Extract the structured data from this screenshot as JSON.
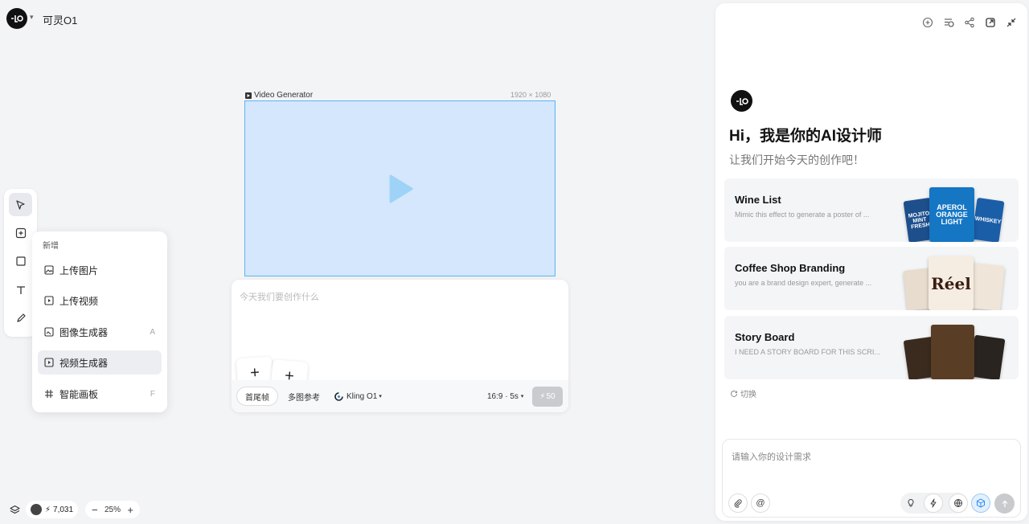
{
  "app": {
    "title": "可灵O1"
  },
  "add_menu": {
    "header": "新增",
    "items": [
      {
        "label": "上传图片",
        "shortcut": ""
      },
      {
        "label": "上传视频",
        "shortcut": ""
      },
      {
        "label": "图像生成器",
        "shortcut": "A"
      },
      {
        "label": "视频生成器",
        "shortcut": ""
      },
      {
        "label": "智能画板",
        "shortcut": "F"
      }
    ]
  },
  "frame": {
    "label": "Video Generator",
    "size": "1920 × 1080"
  },
  "prompt": {
    "placeholder": "今天我们要创作什么",
    "mode_first_last": "首尾帧",
    "mode_multi_ref": "多图参考",
    "model": "Kling O1",
    "settings": "16:9 · 5s",
    "cost": "50"
  },
  "bottom": {
    "credits": "7,031",
    "zoom": "25%"
  },
  "assistant": {
    "greeting": "Hi，我是你的AI设计师",
    "subtitle": "让我们开始今天的创作吧！",
    "cards": [
      {
        "title": "Wine List",
        "desc": "Mimic this effect to generate a poster of ..."
      },
      {
        "title": "Coffee Shop Branding",
        "desc": "you are a brand design expert, generate ..."
      },
      {
        "title": "Story Board",
        "desc": "I NEED A STORY BOARD FOR THIS SCRI..."
      }
    ],
    "thumb_text": {
      "mojito": "MOJITO MINT FRESH",
      "aperol": "APEROL ORANGE LIGHT",
      "whiskey": "WHISKEY",
      "reel": "Réel"
    },
    "switch_label": "切换",
    "input_placeholder": "请输入你的设计需求"
  },
  "colors": {
    "frame_fill": "#d4e7fc",
    "frame_border": "#5cb3ec",
    "accent_blue": "#2a8cf0"
  }
}
